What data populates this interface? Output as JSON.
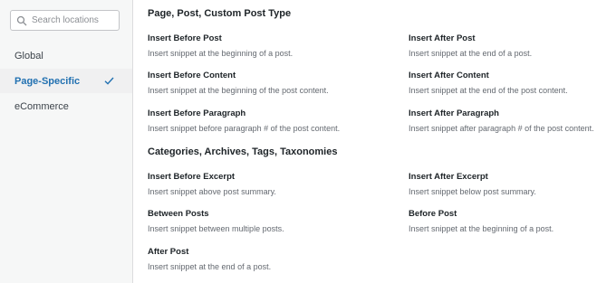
{
  "sidebar": {
    "search_placeholder": "Search locations",
    "items": [
      {
        "label": "Global"
      },
      {
        "label": "Page-Specific"
      },
      {
        "label": "eCommerce"
      }
    ]
  },
  "sections": [
    {
      "title": "Page, Post, Custom Post Type",
      "locations": [
        {
          "title": "Insert Before Post",
          "desc": "Insert snippet at the beginning of a post."
        },
        {
          "title": "Insert After Post",
          "desc": "Insert snippet at the end of a post."
        },
        {
          "title": "Insert Before Content",
          "desc": "Insert snippet at the beginning of the post content."
        },
        {
          "title": "Insert After Content",
          "desc": "Insert snippet at the end of the post content."
        },
        {
          "title": "Insert Before Paragraph",
          "desc": "Insert snippet before paragraph # of the post content."
        },
        {
          "title": "Insert After Paragraph",
          "desc": "Insert snippet after paragraph # of the post content."
        }
      ]
    },
    {
      "title": "Categories, Archives, Tags, Taxonomies",
      "locations": [
        {
          "title": "Insert Before Excerpt",
          "desc": "Insert snippet above post summary."
        },
        {
          "title": "Insert After Excerpt",
          "desc": "Insert snippet below post summary."
        },
        {
          "title": "Between Posts",
          "desc": "Insert snippet between multiple posts."
        },
        {
          "title": "Before Post",
          "desc": "Insert snippet at the beginning of a post."
        },
        {
          "title": "After Post",
          "desc": "Insert snippet at the end of a post."
        }
      ]
    }
  ],
  "colors": {
    "accent": "#2271b1",
    "sidebar_bg": "#f6f7f7"
  }
}
